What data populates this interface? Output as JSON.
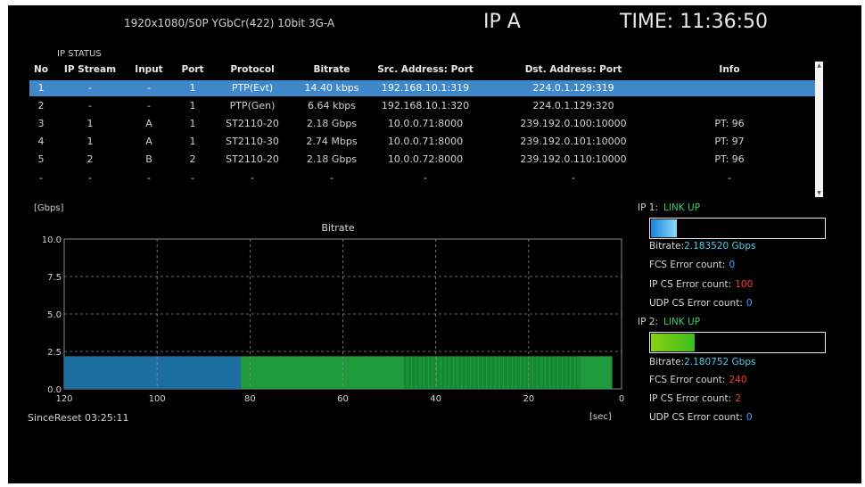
{
  "header": {
    "format": "1920x1080/50P YGbCr(422) 10bit 3G-A",
    "ip_name": "IP A",
    "time": "TIME: 11:36:50"
  },
  "ip_status": {
    "title": "IP STATUS",
    "columns": [
      "No",
      "IP Stream",
      "Input",
      "Port",
      "Protocol",
      "Bitrate",
      "Src. Address: Port",
      "Dst. Address: Port",
      "Info"
    ],
    "rows": [
      {
        "no": "1",
        "stream": "-",
        "input": "-",
        "port": "1",
        "protocol": "PTP(Evt)",
        "bitrate": "14.40 kbps",
        "src": "192.168.10.1:319",
        "dst": "224.0.1.129:319",
        "info": "",
        "selected": true
      },
      {
        "no": "2",
        "stream": "-",
        "input": "-",
        "port": "1",
        "protocol": "PTP(Gen)",
        "bitrate": "6.64 kbps",
        "src": "192.168.10.1:320",
        "dst": "224.0.1.129:320",
        "info": ""
      },
      {
        "no": "3",
        "stream": "1",
        "input": "A",
        "port": "1",
        "protocol": "ST2110-20",
        "bitrate": "2.18 Gbps",
        "src": "10.0.0.71:8000",
        "dst": "239.192.0.100:10000",
        "info": "PT: 96"
      },
      {
        "no": "4",
        "stream": "1",
        "input": "A",
        "port": "1",
        "protocol": "ST2110-30",
        "bitrate": "2.74 Mbps",
        "src": "10.0.0.71:8000",
        "dst": "239.192.0.101:10000",
        "info": "PT: 97"
      },
      {
        "no": "5",
        "stream": "2",
        "input": "B",
        "port": "2",
        "protocol": "ST2110-20",
        "bitrate": "2.18 Gbps",
        "src": "10.0.0.72:8000",
        "dst": "239.192.0.110:10000",
        "info": "PT: 96"
      },
      {
        "no": "-",
        "stream": "-",
        "input": "-",
        "port": "-",
        "protocol": "-",
        "bitrate": "-",
        "src": "-",
        "dst": "-",
        "info": "-"
      }
    ]
  },
  "chart_data": {
    "type": "area",
    "title": "Bitrate",
    "unit_label": "[Gbps]",
    "x_unit_label": "[sec]",
    "xlim": [
      120,
      0
    ],
    "ylim": [
      0,
      10
    ],
    "x_ticks": [
      "120",
      "100",
      "80",
      "60",
      "40",
      "20",
      "0"
    ],
    "y_ticks": [
      "10.0",
      "7.5",
      "5.0",
      "2.5",
      "0.0"
    ],
    "grid": true,
    "series": [
      {
        "color": "#1c6ea0",
        "segments": [
          {
            "x_from": 120,
            "x_to": 82,
            "value": 2.18
          }
        ]
      },
      {
        "color": "#1f9a3d",
        "segments": [
          {
            "x_from": 82,
            "x_to": 47,
            "value": 2.18
          },
          {
            "x_from": 9,
            "x_to": 2,
            "value": 2.18
          }
        ]
      },
      {
        "color": "#148a32",
        "segments": [
          {
            "x_from": 47,
            "x_to": 9,
            "value": 2.18
          }
        ]
      }
    ]
  },
  "footer": {
    "since_reset": "SinceReset 03:25:11"
  },
  "ports": [
    {
      "label": "IP 1:",
      "link": "LINK UP",
      "gauge_fraction": 0.15,
      "gauge_colors": [
        "#1a82d8",
        "#8fdcff"
      ],
      "bitrate_label": "Bitrate:",
      "bitrate_value": "2.183520 Gbps",
      "fcs_label": "FCS Error count:",
      "fcs_value": "0",
      "ipcs_label": "IP CS Error count:",
      "ipcs_value": "100",
      "udpcs_label": "UDP CS Error count:",
      "udpcs_value": "0"
    },
    {
      "label": "IP 2:",
      "link": "LINK UP",
      "gauge_fraction": 0.25,
      "gauge_colors": [
        "#8ccf16",
        "#3bbf1e"
      ],
      "bitrate_label": "Bitrate:",
      "bitrate_value": "2.180752 Gbps",
      "fcs_label": "FCS Error count:",
      "fcs_value": "240",
      "ipcs_label": "IP CS Error count:",
      "ipcs_value": "2",
      "udpcs_label": "UDP CS Error count:",
      "udpcs_value": "0"
    }
  ]
}
